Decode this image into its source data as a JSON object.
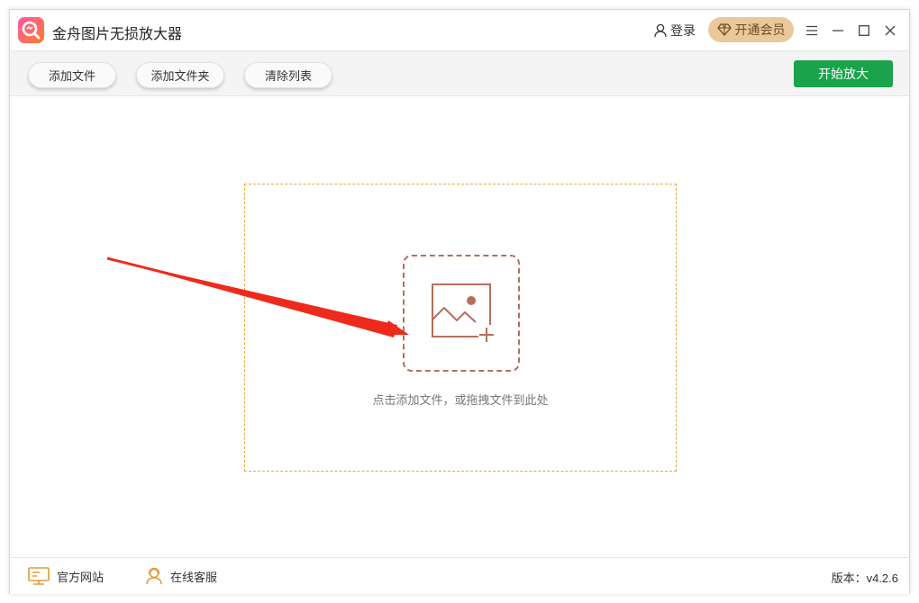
{
  "app": {
    "title": "金舟图片无损放大器",
    "login_label": "登录",
    "vip_label": "开通会员"
  },
  "toolbar": {
    "add_file_label": "添加文件",
    "add_folder_label": "添加文件夹",
    "clear_list_label": "清除列表",
    "start_label": "开始放大"
  },
  "dropzone": {
    "hint": "点击添加文件，或拖拽文件到此处"
  },
  "footer": {
    "website_label": "官方网站",
    "support_label": "在线客服",
    "version_label": "版本：v4.2.6"
  },
  "colors": {
    "start_button": "#1aa34a",
    "vip_button": "#e9c99a",
    "dropzone_border": "#e9a83a",
    "add_box_border": "#b66e5d",
    "arrow": "#ee2a1c"
  },
  "icons": {
    "logo": "app-logo-icon",
    "user": "user-icon",
    "vip": "diamond-icon",
    "menu": "menu-icon",
    "minimize": "minimize-icon",
    "maximize": "maximize-icon",
    "close": "close-icon",
    "add_image": "add-image-icon",
    "website": "monitor-icon",
    "support": "customer-service-icon"
  }
}
